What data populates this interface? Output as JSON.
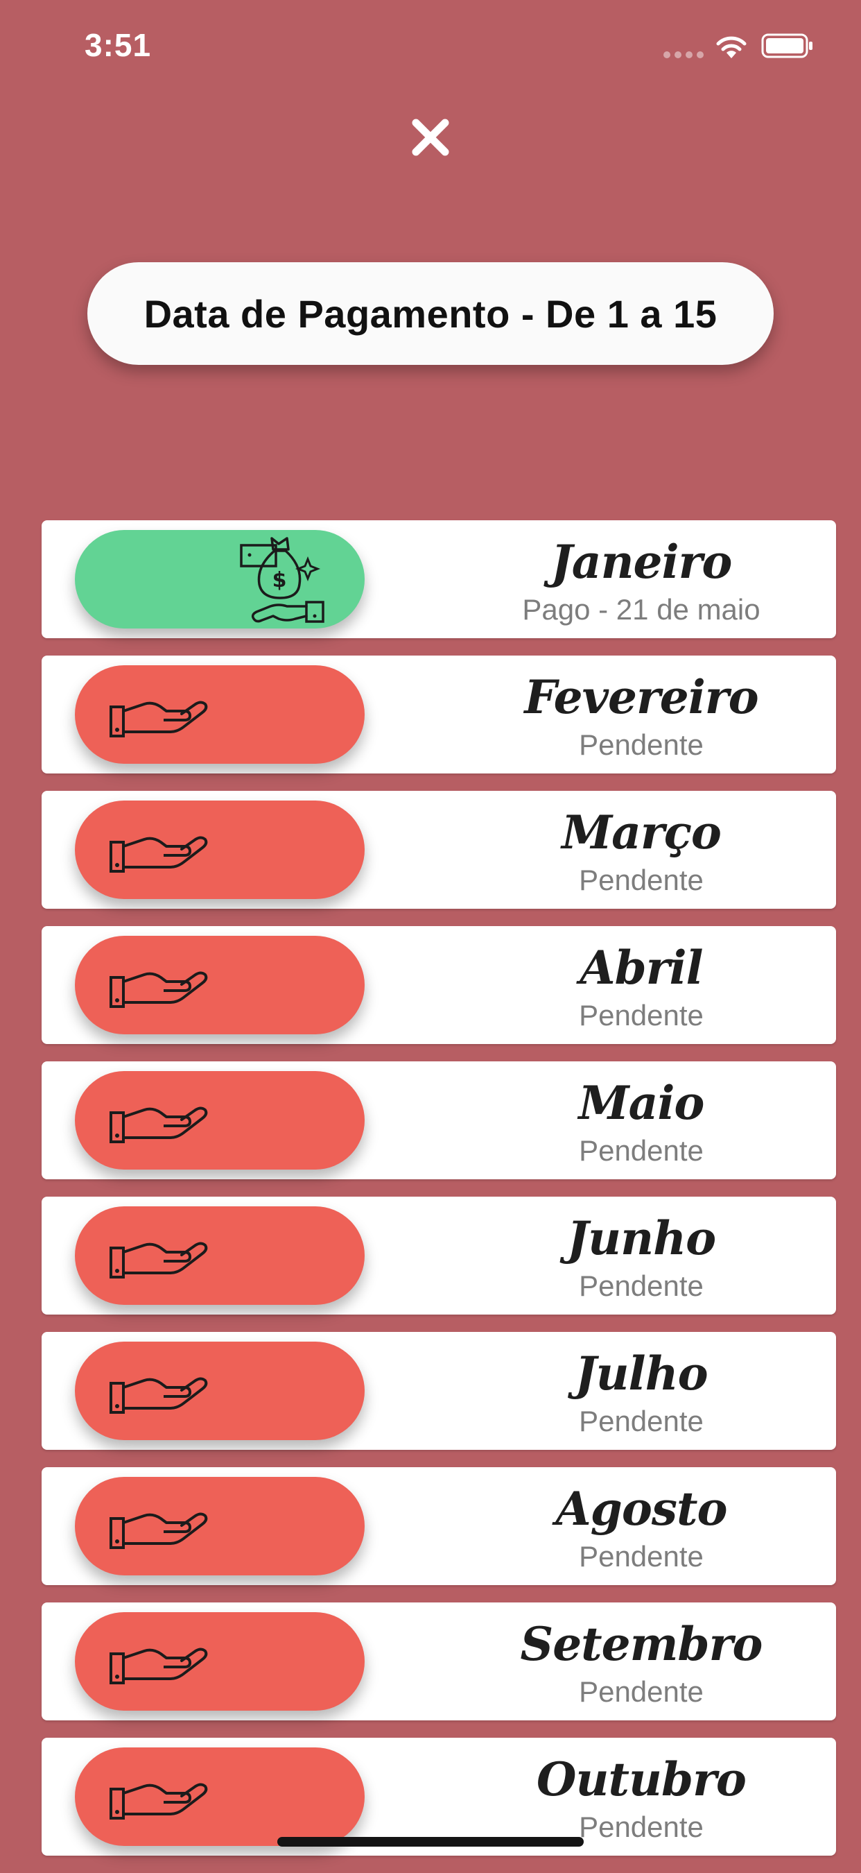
{
  "status_bar": {
    "time": "3:51",
    "icons": [
      "cellular-signal-icon",
      "wifi-icon",
      "battery-icon"
    ]
  },
  "close_icon": "close-icon",
  "header": {
    "title": "Data de Pagamento - De 1 a 15"
  },
  "colors": {
    "background": "#b75e63",
    "paid": "#62d394",
    "pending": "#ee6157",
    "card": "#ffffff"
  },
  "months": [
    {
      "name": "Janeiro",
      "status": "Pago - 21 de maio",
      "paid": true,
      "icon": "money-bag-icon"
    },
    {
      "name": "Fevereiro",
      "status": "Pendente",
      "paid": false,
      "icon": "open-hand-icon"
    },
    {
      "name": "Março",
      "status": "Pendente",
      "paid": false,
      "icon": "open-hand-icon"
    },
    {
      "name": "Abril",
      "status": "Pendente",
      "paid": false,
      "icon": "open-hand-icon"
    },
    {
      "name": "Maio",
      "status": "Pendente",
      "paid": false,
      "icon": "open-hand-icon"
    },
    {
      "name": "Junho",
      "status": "Pendente",
      "paid": false,
      "icon": "open-hand-icon"
    },
    {
      "name": "Julho",
      "status": "Pendente",
      "paid": false,
      "icon": "open-hand-icon"
    },
    {
      "name": "Agosto",
      "status": "Pendente",
      "paid": false,
      "icon": "open-hand-icon"
    },
    {
      "name": "Setembro",
      "status": "Pendente",
      "paid": false,
      "icon": "open-hand-icon"
    },
    {
      "name": "Outubro",
      "status": "Pendente",
      "paid": false,
      "icon": "open-hand-icon"
    }
  ]
}
